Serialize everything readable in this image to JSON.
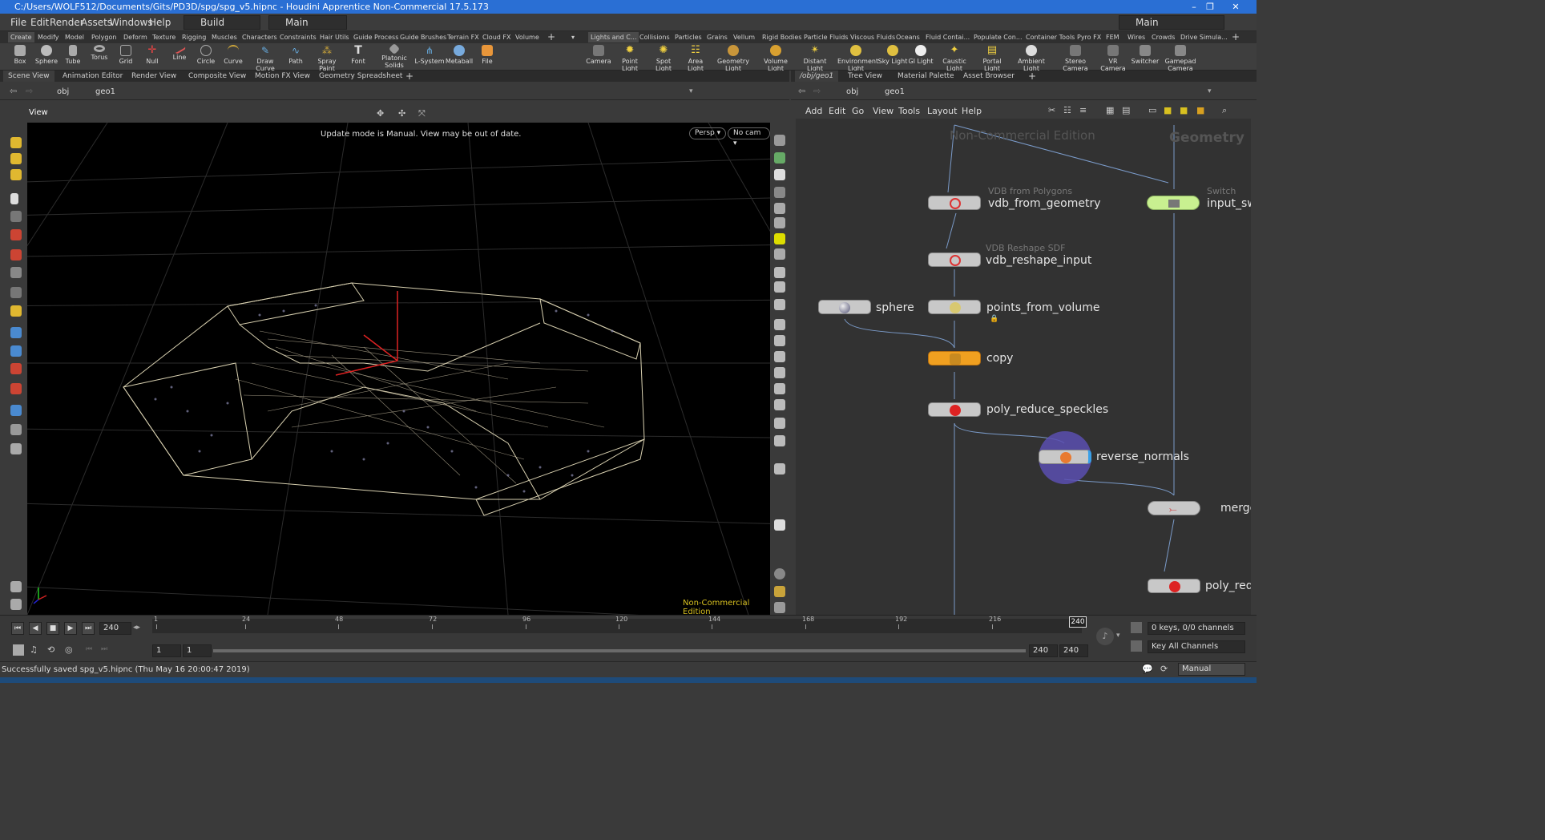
{
  "window": {
    "title": "C:/Users/WOLF512/Documents/Gits/PD3D/spg/spg_v5.hipnc - Houdini Apprentice Non-Commercial 17.5.173"
  },
  "menu": {
    "items": [
      "File",
      "Edit",
      "Render",
      "Assets",
      "Windows",
      "Help"
    ],
    "desktop": "Build",
    "context": "Main",
    "desktop_right": "Main"
  },
  "shelf_left": {
    "tabs": [
      "Create",
      "Modify",
      "Model",
      "Polygon",
      "Deform",
      "Texture",
      "Rigging",
      "Muscles",
      "Characters",
      "Constraints",
      "Hair Utils",
      "Guide Process",
      "Guide Brushes",
      "Terrain FX",
      "Cloud FX",
      "Volume"
    ],
    "tools": [
      "Box",
      "Sphere",
      "Tube",
      "Torus",
      "Grid",
      "Null",
      "Line",
      "Circle",
      "Curve",
      "Draw Curve",
      "Path",
      "Spray Paint",
      "Font",
      "Platonic Solids",
      "L-System",
      "Metaball",
      "File"
    ]
  },
  "shelf_right": {
    "tabs": [
      "Lights and C...",
      "Collisions",
      "Particles",
      "Grains",
      "Vellum",
      "Rigid Bodies",
      "Particle Fluids",
      "Viscous Fluids",
      "Oceans",
      "Fluid Contai...",
      "Populate Con...",
      "Container Tools",
      "Pyro FX",
      "FEM",
      "Wires",
      "Crowds",
      "Drive Simula..."
    ],
    "tools": [
      "Camera",
      "Point Light",
      "Spot Light",
      "Area Light",
      "Geometry Light",
      "Volume Light",
      "Distant Light",
      "Environment Light",
      "Sky Light",
      "GI Light",
      "Caustic Light",
      "Portal Light",
      "Ambient Light",
      "Stereo Camera",
      "VR Camera",
      "Switcher",
      "Gamepad Camera"
    ]
  },
  "left_pane": {
    "tabs": [
      "Scene View",
      "Animation Editor",
      "Render View",
      "Composite View",
      "Motion FX View",
      "Geometry Spreadsheet"
    ],
    "path": [
      "obj",
      "geo1"
    ],
    "view_label": "View",
    "message": "Update mode is Manual. View may be out of date.",
    "persp": "Persp",
    "cam": "No cam",
    "watermark": "Non-Commercial Edition"
  },
  "right_pane": {
    "tabs": [
      "/obj/geo1",
      "Tree View",
      "Material Palette",
      "Asset Browser"
    ],
    "path": [
      "obj",
      "geo1"
    ],
    "menu": [
      "Add",
      "Edit",
      "Go",
      "View",
      "Tools",
      "Layout",
      "Help"
    ],
    "watermark": "Non-Commercial Edition",
    "context_label": "Geometry"
  },
  "nodes": {
    "vdb_from_geometry": {
      "name": "vdb_from_geometry",
      "type": "VDB from Polygons"
    },
    "vdb_reshape_input": {
      "name": "vdb_reshape_input",
      "type": "VDB Reshape SDF"
    },
    "sphere": {
      "name": "sphere"
    },
    "points_from_volume": {
      "name": "points_from_volume"
    },
    "copy": {
      "name": "copy"
    },
    "poly_reduce_speckles": {
      "name": "poly_reduce_speckles"
    },
    "reverse_normals": {
      "name": "reverse_normals"
    },
    "input_switch": {
      "name": "input_sw",
      "type": "Switch"
    },
    "merge": {
      "name": "merge"
    },
    "poly_reduce": {
      "name": "poly_redu"
    }
  },
  "timeline": {
    "current_frame": "240",
    "ticks": [
      "1",
      "24",
      "48",
      "72",
      "96",
      "120",
      "144",
      "168",
      "192",
      "216",
      "240"
    ],
    "range_start": "1",
    "range_start2": "1",
    "range_end": "240",
    "range_end2": "240",
    "keys": "0 keys, 0/0 channels",
    "key_all": "Key All Channels",
    "update_mode": "Manual"
  },
  "status": {
    "message": "Successfully saved spg_v5.hipnc (Thu May 16 20:00:47 2019)"
  },
  "colors": {
    "title_bg": "#2a6fd4",
    "copy_node": "#f0a020",
    "switch_node": "#c8f090",
    "accent_watermark": "#d8c020"
  }
}
